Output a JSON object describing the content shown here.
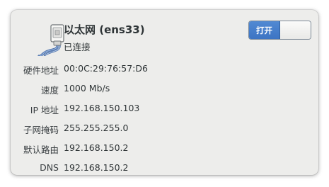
{
  "connection": {
    "title": "以太网 (ens33)",
    "status": "已连接",
    "toggle_label": "打开",
    "toggle_state": "on",
    "icon": "ethernet-cable-icon",
    "accent_color": "#3d74c3"
  },
  "details": [
    {
      "label": "硬件地址",
      "value": "00:0C:29:76:57:D6"
    },
    {
      "label": "速度",
      "value": "1000 Mb/s"
    },
    {
      "label": "IP 地址",
      "value": "192.168.150.103"
    },
    {
      "label": "子网掩码",
      "value": "255.255.255.0"
    },
    {
      "label": "默认路由",
      "value": "192.168.150.2"
    },
    {
      "label": "DNS",
      "value": "192.168.150.2"
    }
  ]
}
